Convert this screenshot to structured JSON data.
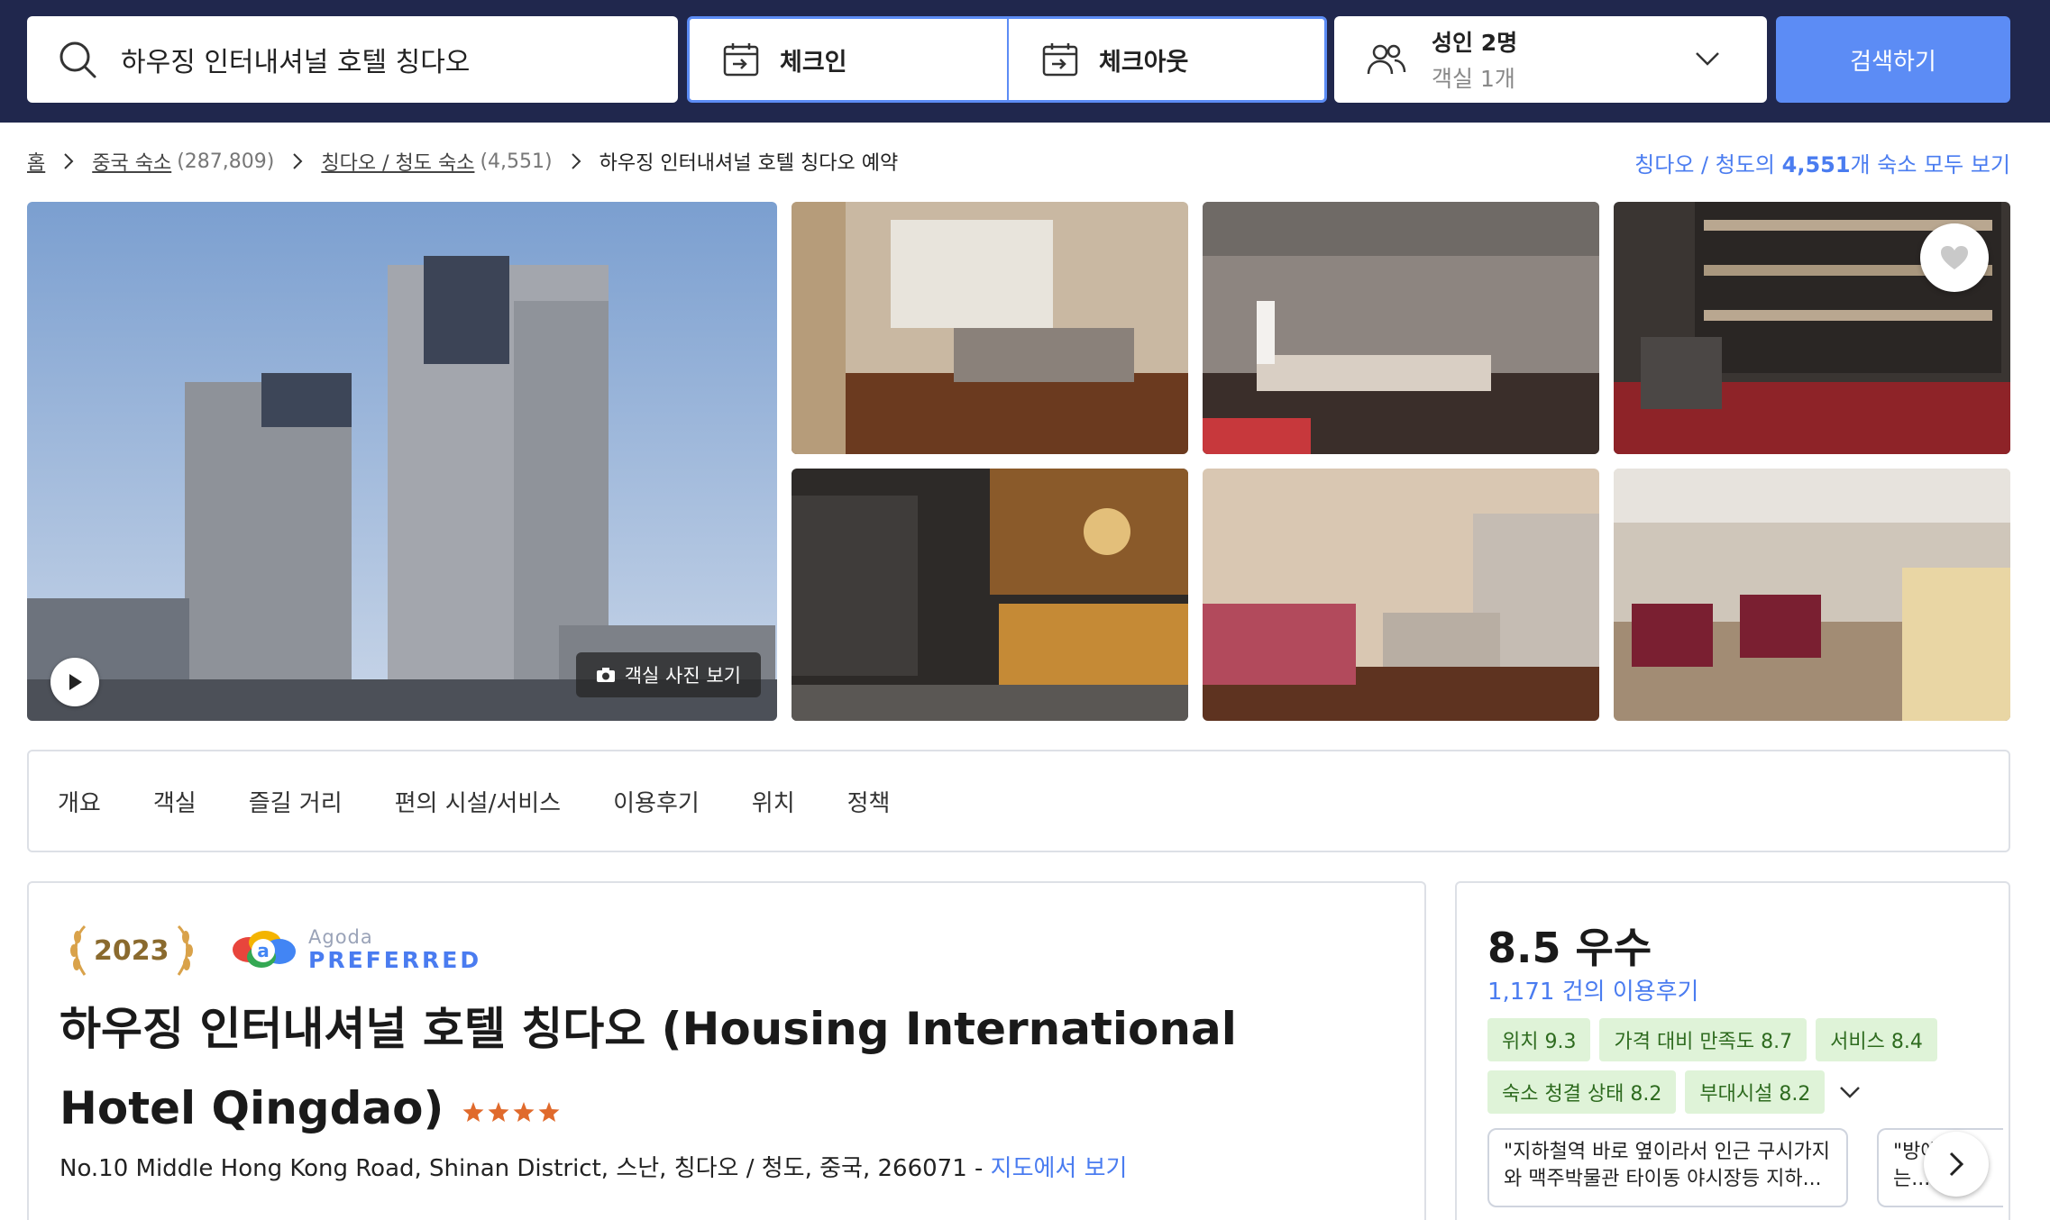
{
  "search": {
    "destination": "하우징 인터내셔널 호텔 칭다오",
    "checkin_label": "체크인",
    "checkout_label": "체크아웃",
    "occupancy_main": "성인 2명",
    "occupancy_sub": "객실 1개",
    "search_button": "검색하기"
  },
  "breadcrumb": {
    "home": "홈",
    "items": [
      {
        "label": "중국 숙소",
        "count": "(287,809)"
      },
      {
        "label": "칭다오 / 청도 숙소",
        "count": "(4,551)"
      }
    ],
    "current": "하우징 인터내셔널 호텔 칭다오 예약"
  },
  "see_all": {
    "prefix": "칭다오 / 청도의 ",
    "count": "4,551",
    "suffix": "개 숙소 모두 보기"
  },
  "gallery": {
    "room_photos_button": "객실 사진 보기"
  },
  "tabs": [
    "개요",
    "객실",
    "즐길 거리",
    "편의 시설/서비스",
    "이용후기",
    "위치",
    "정책"
  ],
  "hotel": {
    "award_year": "2023",
    "badge_top": "Agoda",
    "badge_bottom": "PREFERRED",
    "name": "하우징 인터내셔널 호텔 칭다오 (Housing International Hotel Qingdao)",
    "star_rating": 4,
    "address": "No.10 Middle Hong Kong Road, Shinan District, 스난, 칭다오 / 청도, 중국, 266071 - ",
    "map_link": "지도에서 보기"
  },
  "review": {
    "score_text": "8.5 우수",
    "count_text": "1,171 건의 이용후기",
    "chips": [
      "위치 9.3",
      "가격 대비 만족도 8.7",
      "서비스 8.4",
      "숙소 청결 상태 8.2",
      "부대시설 8.2"
    ],
    "snippets": [
      "\"지하철역 바로 옆이라서 인근 구시가지와 맥주박물관 타이동 야시장등 지하...",
      "\"방에서 보는..."
    ]
  },
  "colors": {
    "header_bg": "#20274d",
    "accent_blue": "#5c8cf5",
    "link_blue": "#4a7cf0",
    "chip_bg": "#dff3d8",
    "chip_text": "#2e6b1f",
    "star": "#e06a2c"
  }
}
